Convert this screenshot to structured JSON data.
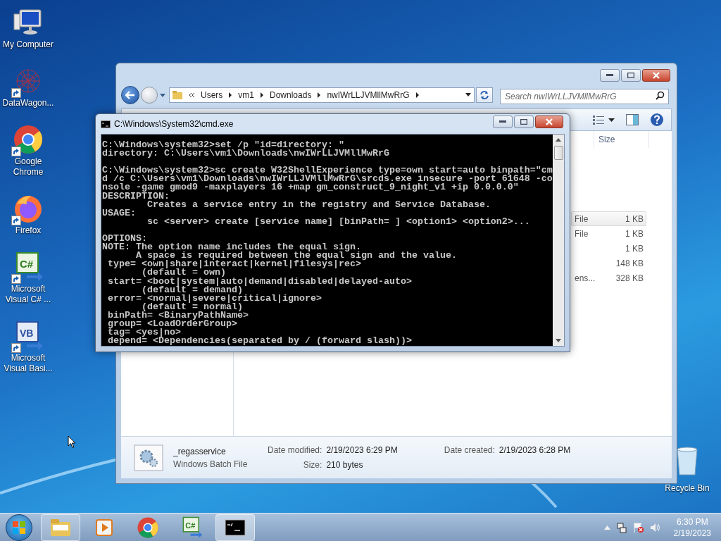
{
  "desktop_icons": [
    {
      "kind": "computer",
      "label": [
        "My Computer"
      ]
    },
    {
      "kind": "web-art",
      "label": [
        "DataWagon..."
      ]
    },
    {
      "kind": "chrome",
      "label": [
        "Google",
        "Chrome"
      ]
    },
    {
      "kind": "firefox",
      "label": [
        "Firefox"
      ]
    },
    {
      "kind": "csharp",
      "logo": "C#",
      "label": [
        "Microsoft",
        "Visual C# ..."
      ]
    },
    {
      "kind": "vb",
      "logo": "VB",
      "label": [
        "Microsoft",
        "Visual Basi..."
      ]
    }
  ],
  "recycle_bin": {
    "label": "Recycle Bin"
  },
  "explorer": {
    "breadcrumb": [
      "Users",
      "vm1",
      "Downloads",
      "nwIWrLLJVMllMwRrG"
    ],
    "search": {
      "placeholder": "Search nwIWrLLJVMllMwRrG"
    },
    "columns": [
      {
        "label": "Size"
      }
    ],
    "rows": [
      {
        "type": "File",
        "size": "1 KB",
        "selected": true
      },
      {
        "type": "File",
        "size": "1 KB",
        "selected": false
      },
      {
        "size": "1 KB",
        "selected": false
      },
      {
        "size": "148 KB",
        "selected": false
      },
      {
        "type": "ens...",
        "size": "328 KB",
        "selected": false
      }
    ],
    "details": {
      "name": "_regasservice",
      "file_type": "Windows Batch File",
      "fields": [
        {
          "label": "Date modified:",
          "value": "2/19/2023 6:29 PM"
        },
        {
          "label": "Date created:",
          "value": "2/19/2023 6:28 PM"
        },
        {
          "label": "Size:",
          "value": "210 bytes"
        }
      ]
    }
  },
  "cmd": {
    "title": "C:\\Windows\\System32\\cmd.exe",
    "blocks": [
      [
        "C:\\Windows\\system32>set /p \"id=directory: \"",
        "directory: C:\\Users\\vm1\\Downloads\\nwIWrLLJVMllMwRrG"
      ],
      [
        "C:\\Windows\\system32>sc create W32ShellExperience type=own start=auto binpath=\"cm",
        "d /c C:\\Users\\vm1\\Downloads\\nwIWrLLJVMllMwRrG\\srcds.exe insecure -port 61648 -co",
        "nsole -game gmod9 -maxplayers 16 +map gm_construct_9_night_v1 +ip 0.0.0.0\"",
        "DESCRIPTION:",
        "        Creates a service entry in the registry and Service Database.",
        "USAGE:",
        "        sc <server> create [service name] [binPath= ] <option1> <option2>..."
      ],
      [
        "OPTIONS:",
        "NOTE: The option name includes the equal sign.",
        "      A space is required between the equal sign and the value.",
        " type= <own|share|interact|kernel|filesys|rec>",
        "       (default = own)",
        " start= <boot|system|auto|demand|disabled|delayed-auto>",
        "       (default = demand)",
        " error= <normal|severe|critical|ignore>",
        "       (default = normal)",
        " binPath= <BinaryPathName>",
        " group= <LoadOrderGroup>",
        " tag= <yes|no>",
        " depend= <Dependencies(separated by / (forward slash))>"
      ]
    ]
  },
  "taskbar": {
    "items": [
      {
        "kind": "explorer",
        "open": true,
        "selected": false
      },
      {
        "kind": "media",
        "open": false,
        "selected": false
      },
      {
        "kind": "chrome",
        "open": false,
        "selected": false
      },
      {
        "kind": "csharp",
        "logo": "C#",
        "open": false,
        "selected": false
      },
      {
        "kind": "console",
        "open": true,
        "selected": true
      }
    ],
    "clock": {
      "time": "6:30 PM",
      "date": "2/19/2023"
    }
  }
}
